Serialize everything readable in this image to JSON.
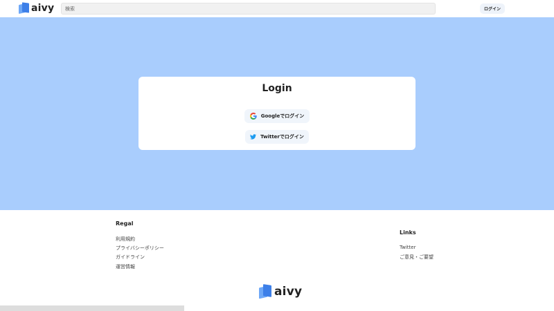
{
  "header": {
    "brand": "aivy",
    "search_placeholder": "検索",
    "login_label": "ログイン"
  },
  "login_card": {
    "title": "Login",
    "google_label": "Googleでログイン",
    "twitter_label": "Twitterでログイン"
  },
  "footer": {
    "regal": {
      "heading": "Regal",
      "links": [
        "利用規約",
        "プライバシーポリシー",
        "ガイドライン",
        "運営情報"
      ]
    },
    "links": {
      "heading": "Links",
      "items": [
        "Twitter",
        "ご意見・ご要望"
      ]
    },
    "brand": "aivy"
  },
  "colors": {
    "hero_bg": "#a9cdfd",
    "brand_blue": "#3d7fe8",
    "twitter_blue": "#1d9bf0"
  }
}
